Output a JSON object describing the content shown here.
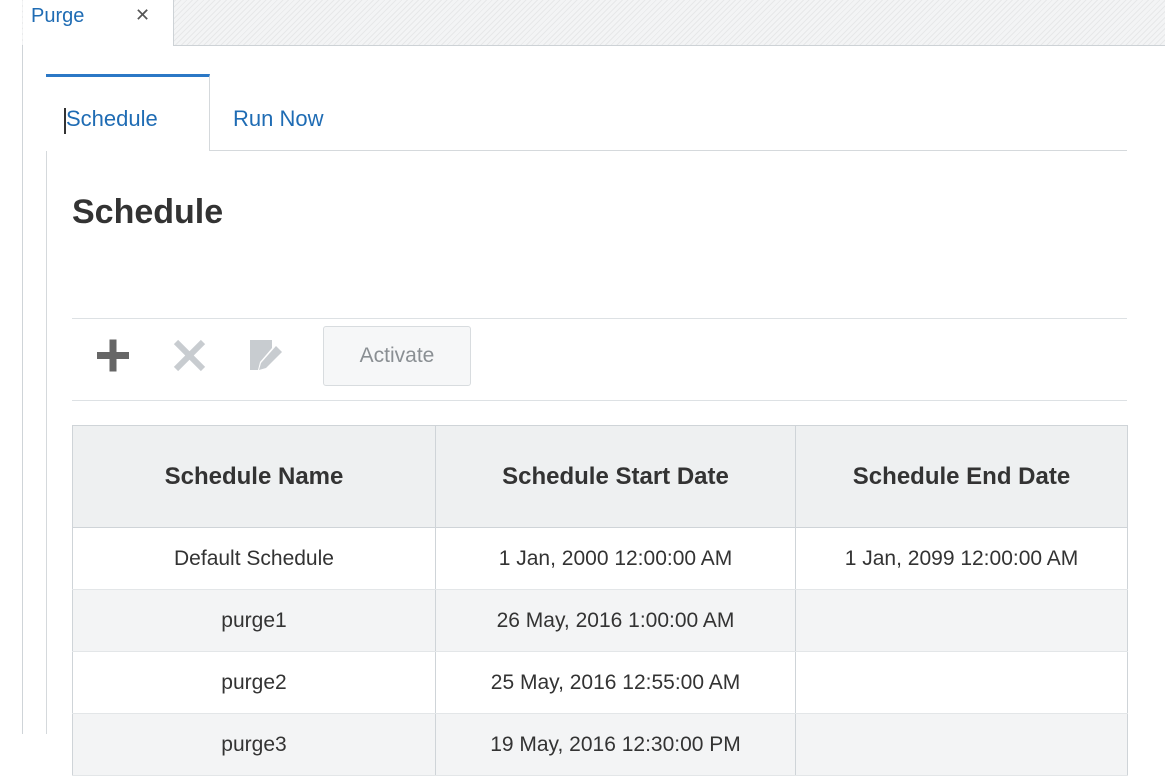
{
  "document_tab": {
    "label": "Purge",
    "close_glyph": "✕"
  },
  "subtabs": [
    {
      "label": "Schedule",
      "active": true
    },
    {
      "label": "Run Now",
      "active": false
    }
  ],
  "page": {
    "title": "Schedule"
  },
  "toolbar": {
    "add_icon": "plus-icon",
    "delete_icon": "close-icon",
    "edit_icon": "edit-icon",
    "activate_label": "Activate"
  },
  "table": {
    "columns": [
      "Schedule Name",
      "Schedule Start Date",
      "Schedule End Date"
    ],
    "rows": [
      [
        "Default Schedule",
        "1 Jan, 2000 12:00:00 AM",
        "1 Jan, 2099 12:00:00 AM"
      ],
      [
        "purge1",
        "26 May, 2016 1:00:00 AM",
        ""
      ],
      [
        "purge2",
        "25 May, 2016 12:55:00 AM",
        ""
      ],
      [
        "purge3",
        "19 May, 2016 12:30:00 PM",
        ""
      ]
    ]
  },
  "colors": {
    "accent": "#2b78c6",
    "link": "#1f6cb4",
    "header_bg": "#eef0f1",
    "disabled_icon": "#c5c9cc"
  }
}
